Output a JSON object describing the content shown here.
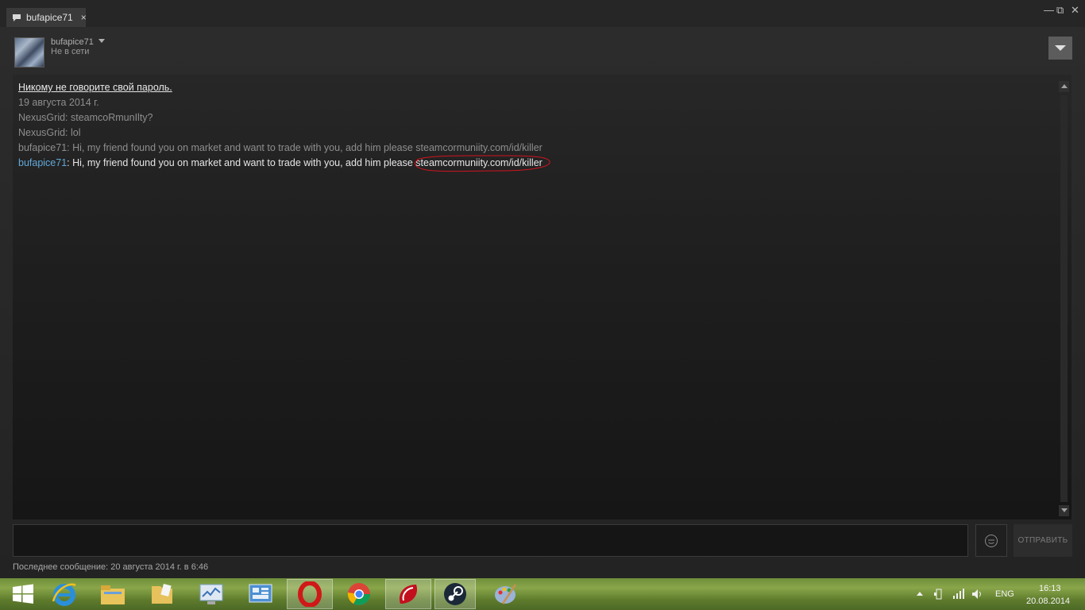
{
  "window": {
    "tab_title": "bufapice71",
    "tab_close": "×",
    "minimize": "—",
    "maximize": "⧉",
    "close": "✕"
  },
  "header": {
    "username": "bufapice71",
    "status": "Не в сети"
  },
  "chat": {
    "warning": "Никому не говорите свой пароль.",
    "date": "19 августа 2014 г.",
    "messages": [
      {
        "text": "NexusGrid: steamcoRmunIlty?"
      },
      {
        "text": "NexusGrid: lol"
      },
      {
        "text": "bufapice71: Hi, my friend found  you on market and want to trade with you, add him please steamcormuniity.com/id/killer"
      },
      {
        "sender": "bufapice71",
        "body": ": Hi, my friend found  you on market and want to trade with you, add him please ",
        "link": "steamcormuniity.com/id/killer"
      }
    ]
  },
  "input": {
    "placeholder": "",
    "send_label": "ОТПРАВИТЬ"
  },
  "footer": {
    "last_message": "Последнее сообщение: 20 августа 2014 г. в 6:46"
  },
  "taskbar": {
    "items": [
      {
        "name": "start",
        "color": "#ffffff"
      },
      {
        "name": "internet-explorer",
        "color": "#2a8fd8"
      },
      {
        "name": "file-explorer",
        "color": "#e8c45a"
      },
      {
        "name": "folder",
        "color": "#e8c45a"
      },
      {
        "name": "resource-monitor",
        "color": "#7aa0c8"
      },
      {
        "name": "control-panel",
        "color": "#4d8fd1"
      },
      {
        "name": "opera",
        "color": "#d01818"
      },
      {
        "name": "chrome",
        "color": "#e0b020"
      },
      {
        "name": "red-app",
        "color": "#c3101e"
      },
      {
        "name": "steam",
        "color": "#1b2838"
      },
      {
        "name": "paint",
        "color": "#9ab3d6"
      }
    ],
    "language": "ENG",
    "time": "16:13",
    "date": "20.08.2014"
  }
}
